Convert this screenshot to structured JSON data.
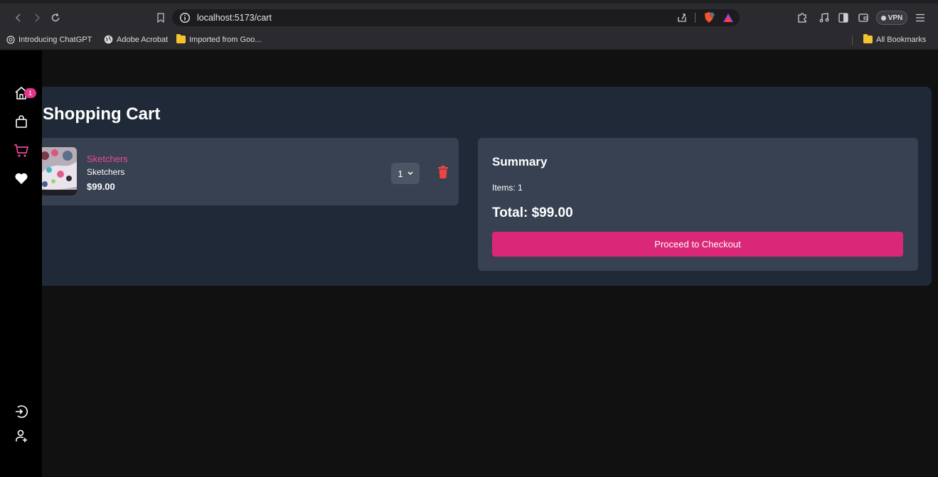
{
  "browser": {
    "url": "localhost:5173/cart",
    "vpn_label": "VPN",
    "bookmarks": [
      {
        "label": "Introducing ChatGPT",
        "icon": "chatgpt-icon"
      },
      {
        "label": "Adobe Acrobat",
        "icon": "globe-icon"
      },
      {
        "label": "Imported from Goo...",
        "icon": "folder-icon"
      }
    ],
    "all_bookmarks": "All Bookmarks"
  },
  "sidebar": {
    "items": [
      {
        "name": "home",
        "icon": "home-icon"
      },
      {
        "name": "shop",
        "icon": "shopping-bag-icon"
      },
      {
        "name": "cart",
        "icon": "cart-icon"
      },
      {
        "name": "favorites",
        "icon": "heart-icon"
      },
      {
        "name": "login",
        "icon": "login-icon"
      },
      {
        "name": "register",
        "icon": "user-plus-icon"
      }
    ],
    "cart_badge": "1"
  },
  "cart": {
    "title": "Shopping Cart",
    "items": [
      {
        "name": "Sketchers",
        "brand": "Sketchers",
        "price": "$99.00",
        "quantity": "1"
      }
    ]
  },
  "summary": {
    "title": "Summary",
    "items_text": "Items: 1",
    "total_text": "Total: $99.00",
    "checkout_label": "Proceed to Checkout"
  },
  "colors": {
    "accent": "#db2777",
    "item_name": "#ec4899",
    "trash": "#ef4444",
    "panel": "#1f2937",
    "card": "#374151"
  }
}
